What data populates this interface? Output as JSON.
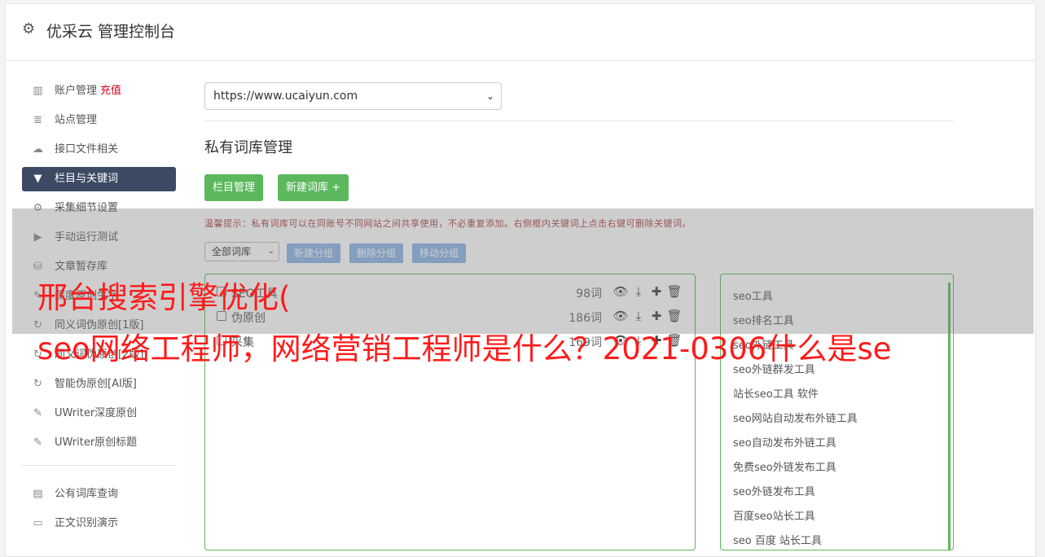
{
  "header": {
    "title": "优采云 管理控制台",
    "icon": "gear-icon"
  },
  "sidebar": {
    "items": [
      {
        "label": "账户管理",
        "extra": "充值",
        "icon": "bar-chart-icon",
        "glyph": "▥",
        "active": false
      },
      {
        "label": "站点管理",
        "icon": "server-icon",
        "glyph": "≣",
        "active": false
      },
      {
        "label": "接口文件相关",
        "icon": "cloud-upload-icon",
        "glyph": "☁",
        "active": false
      },
      {
        "label": "栏目与关键词",
        "icon": "filter-icon",
        "glyph": "▼",
        "active": true
      },
      {
        "label": "采集细节设置",
        "icon": "cogs-icon",
        "glyph": "⚙",
        "active": false
      },
      {
        "label": "手动运行测试",
        "icon": "play-circle-icon",
        "glyph": "▶",
        "active": false
      },
      {
        "label": "文章暂存库",
        "icon": "database-icon",
        "glyph": "⛁",
        "active": false
      },
      {
        "label": "深度原创生字",
        "icon": "edit-icon",
        "glyph": "✎",
        "active": false
      },
      {
        "label": "同义词伪原创[1版]",
        "icon": "refresh-icon",
        "glyph": "↻",
        "active": false
      },
      {
        "label": "同义词伪原创[2版]",
        "icon": "refresh-icon",
        "glyph": "↻",
        "active": false
      },
      {
        "label": "智能伪原创[AI版]",
        "icon": "refresh-icon",
        "glyph": "↻",
        "active": false
      },
      {
        "label": "UWriter深度原创",
        "icon": "edit-icon",
        "glyph": "✎",
        "active": false
      },
      {
        "label": "UWriter原创标题",
        "icon": "edit-icon",
        "glyph": "✎",
        "active": false
      }
    ],
    "items2": [
      {
        "label": "公有词库查询",
        "icon": "book-icon",
        "glyph": "▤"
      },
      {
        "label": "正文识别演示",
        "icon": "monitor-icon",
        "glyph": "▭"
      }
    ]
  },
  "main": {
    "site_select": "https://www.ucaiyun.com",
    "section_title": "私有词库管理",
    "btn_columns": "栏目管理",
    "btn_new_lib": "新建词库 +",
    "tip": "温馨提示：私有词库可以在同账号不同网站之间共享使用，不必重复添加。右侧框内关键词上点击右键可删除关键词。",
    "filter_select": "全部词库",
    "btn_new_group": "新建分组",
    "btn_del_group": "删除分组",
    "btn_move_group": "移动分组",
    "libraries": [
      {
        "name": "SEO工具",
        "count": "98词"
      },
      {
        "name": "伪原创",
        "count": "186词"
      },
      {
        "name": "采集",
        "count": "169词"
      }
    ],
    "keywords": [
      "seo工具",
      "seo排名工具",
      "seo外链工具",
      "seo外链群发工具",
      "站长seo工具 软件",
      "seo网站自动发布外链工具",
      "seo自动发布外链工具",
      "免费seo外链发布工具",
      "seo外链发布工具",
      "百度seo站长工具",
      "seo 百度 站长工具"
    ]
  },
  "overlay": {
    "line1": "邢台搜索引擎优化(",
    "line2": "seo网络工程师，网络营销工程师是什么？2021-0306什么是se"
  }
}
